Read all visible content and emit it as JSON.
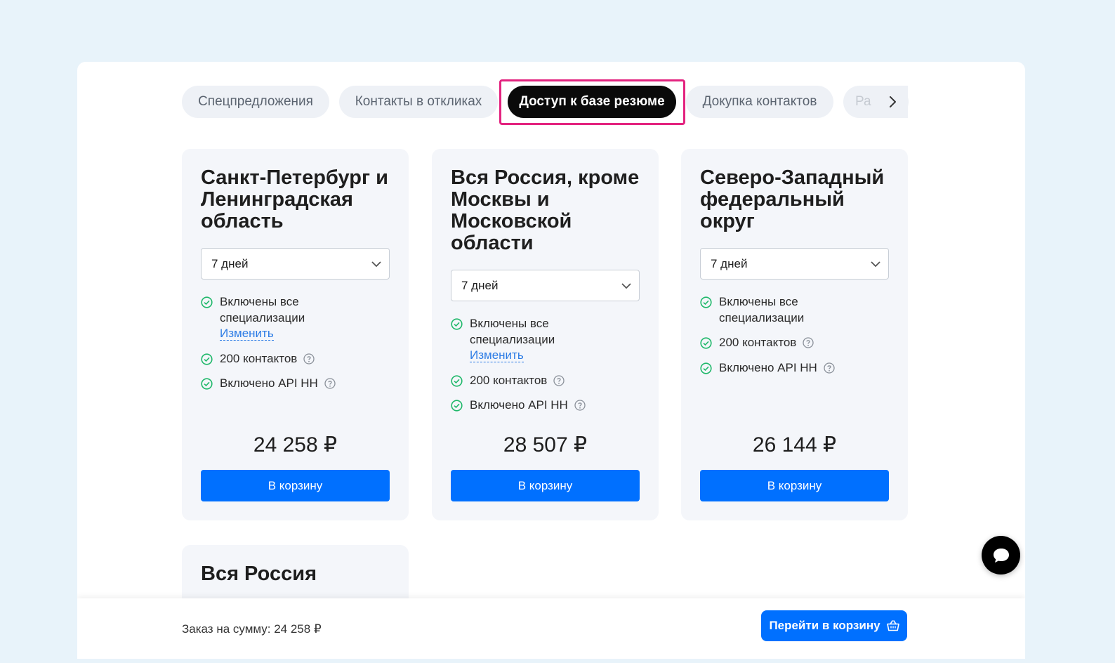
{
  "tabs": [
    {
      "label": "Спецпредложения",
      "active": false
    },
    {
      "label": "Контакты в откликах",
      "active": false
    },
    {
      "label": "Доступ к базе резюме",
      "active": true
    },
    {
      "label": "Докупка контактов",
      "active": false
    },
    {
      "label": "Ра",
      "active": false
    }
  ],
  "highlight_color": "#e3237f",
  "cards": [
    {
      "title": "Санкт-Петербург и Ленинградская область",
      "duration": "7 дней",
      "features": {
        "specializations": "Включены все специализации",
        "change_link": "Изменить",
        "contacts": "200 контактов",
        "api": "Включено API HH"
      },
      "price": "24 258 ₽",
      "button": "В корзину"
    },
    {
      "title": "Вся Россия, кроме Москвы и Московской области",
      "duration": "7 дней",
      "features": {
        "specializations": "Включены все специализации",
        "change_link": "Изменить",
        "contacts": "200 контактов",
        "api": "Включено API HH"
      },
      "price": "28 507 ₽",
      "button": "В корзину"
    },
    {
      "title": "Северо-Западный федеральный округ",
      "duration": "7 дней",
      "features": {
        "specializations": "Включены все специализации",
        "contacts": "200 контактов",
        "api": "Включено API HH"
      },
      "price": "26 144 ₽",
      "button": "В корзину"
    },
    {
      "title": "Вся Россия"
    }
  ],
  "footer": {
    "order_sum": "Заказ на сумму: 24 258 ₽",
    "go_to_cart": "Перейти в корзину"
  },
  "colors": {
    "primary_button": "#0070ff",
    "active_tab": "#0a0a0a",
    "check": "#1fb86a",
    "link": "#2b7be5"
  }
}
